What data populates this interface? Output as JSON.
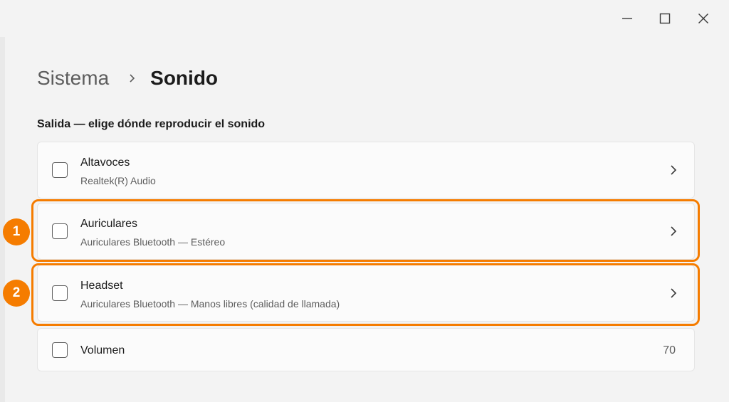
{
  "titlebar": {
    "minimize_icon": "minimize-icon",
    "maximize_icon": "maximize-icon",
    "close_icon": "close-icon"
  },
  "breadcrumb": {
    "parent": "Sistema",
    "separator_icon": "chevron-right-icon",
    "current": "Sonido"
  },
  "section_title": "Salida — elige dónde reproducir el sonido",
  "devices": [
    {
      "title": "Altavoces",
      "subtitle": "Realtek(R) Audio"
    },
    {
      "title": "Auriculares",
      "subtitle": "Auriculares Bluetooth — Estéreo"
    },
    {
      "title": "Headset",
      "subtitle": "Auriculares Bluetooth — Manos libres (calidad de llamada)"
    }
  ],
  "volume": {
    "label": "Volumen",
    "value": "70"
  },
  "annotations": [
    {
      "number": "1"
    },
    {
      "number": "2"
    }
  ],
  "colors": {
    "highlight": "#f57c00",
    "window_bg": "#f3f3f3",
    "card_bg": "#fbfbfb"
  }
}
